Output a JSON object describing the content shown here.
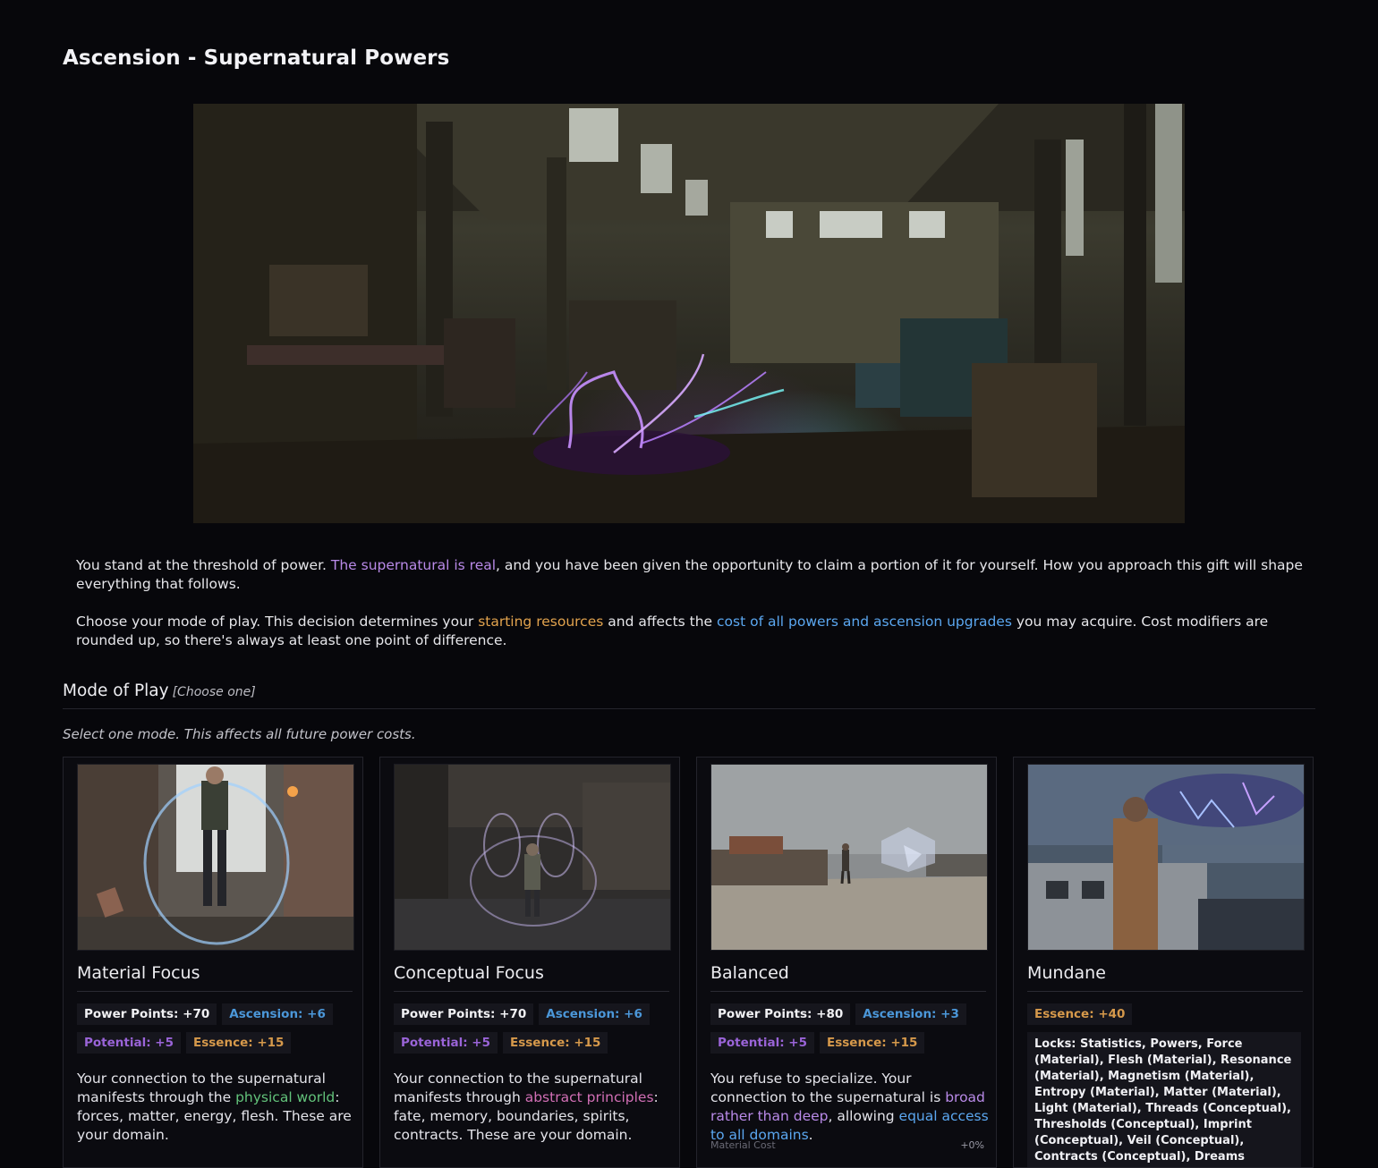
{
  "page": {
    "title": "Ascension - Supernatural Powers"
  },
  "intro": {
    "p1": {
      "before": "You stand at the threshold of power. ",
      "highlight": "The supernatural is real",
      "after": ", and you have been given the opportunity to claim a portion of it for yourself. How you approach this gift will shape everything that follows."
    },
    "p2": {
      "before": "Choose your mode of play. This decision determines your ",
      "highlight1": "starting resources",
      "mid": " and affects the ",
      "highlight2": "cost of all powers and ascension upgrades",
      "after": " you may acquire. Cost modifiers are rounded up, so there's always at least one point of difference."
    }
  },
  "section": {
    "title": "Mode of Play",
    "hint": "[Choose one]",
    "subhint": "Select one mode. This affects all future power costs."
  },
  "cards": [
    {
      "title": "Material Focus",
      "badges": {
        "pp": "Power Points: +70",
        "asc": "Ascension: +6",
        "pot": "Potential: +5",
        "ess": "Essence: +15"
      },
      "desc": {
        "before": "Your connection to the supernatural manifests through the ",
        "highlight": "physical world",
        "after": ": forces, matter, energy, flesh. These are your domain."
      }
    },
    {
      "title": "Conceptual Focus",
      "badges": {
        "pp": "Power Points: +70",
        "asc": "Ascension: +6",
        "pot": "Potential: +5",
        "ess": "Essence: +15"
      },
      "desc": {
        "before": "Your connection to the supernatural manifests through ",
        "highlight": "abstract principles",
        "after": ": fate, memory, boundaries, spirits, contracts. These are your domain."
      }
    },
    {
      "title": "Balanced",
      "badges": {
        "pp": "Power Points: +80",
        "asc": "Ascension: +3",
        "pot": "Potential: +5",
        "ess": "Essence: +15"
      },
      "desc": {
        "before": "You refuse to specialize. Your connection to the supernatural is ",
        "highlight": "broad rather than deep",
        "mid": ", allowing ",
        "highlight2": "equal access to all domains",
        "after": "."
      },
      "cost": {
        "label": "Material Cost",
        "value": "+0%"
      }
    },
    {
      "title": "Mundane",
      "badges": {
        "ess": "Essence: +40"
      },
      "locks": "Locks: Statistics, Powers, Force (Material), Flesh (Material), Resonance (Material), Magnetism (Material), Entropy (Material), Matter (Material), Light (Material), Threads (Conceptual), Thresholds (Conceptual), Imprint (Conceptual), Veil (Conceptual), Contracts (Conceptual), Dreams"
    }
  ]
}
